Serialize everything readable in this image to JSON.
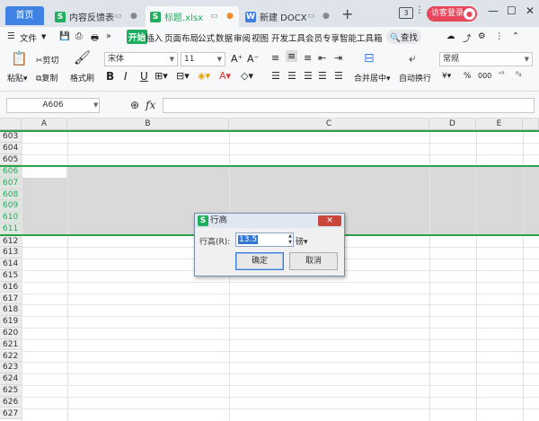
{
  "tabs": {
    "home": "首页",
    "doc1": "内容反馈表",
    "doc2": "标题.xlsx",
    "doc3": "新建 DOCX 文"
  },
  "window": {
    "badge": "3",
    "visitor": "访客登录"
  },
  "menu": {
    "file": "文件",
    "items": [
      "开始",
      "插入",
      "页面布局",
      "公式",
      "数据",
      "审阅",
      "视图",
      "开发工具",
      "会员专享",
      "智能工具箱"
    ],
    "search": "查找"
  },
  "ribbon": {
    "cut": "剪切",
    "paste": "粘贴",
    "copy": "复制",
    "format_painter": "格式刷",
    "font_name": "宋体",
    "font_size": "11",
    "bold": "B",
    "italic": "I",
    "underline": "U",
    "merge": "合并居中",
    "wrap": "自动换行",
    "number_format": "常规",
    "currency": "¥",
    "percent": "%",
    "thousands": "000"
  },
  "formula_bar": {
    "name_box": "A606",
    "fx": "fx"
  },
  "grid": {
    "columns": [
      "A",
      "B",
      "C",
      "D",
      "E"
    ],
    "rows": [
      "603",
      "604",
      "605",
      "606",
      "607",
      "608",
      "609",
      "610",
      "611",
      "612",
      "613",
      "614",
      "615",
      "616",
      "617",
      "618",
      "619",
      "620",
      "621",
      "622",
      "623",
      "624",
      "625",
      "626",
      "627"
    ],
    "selected_rows": [
      "606",
      "607",
      "608",
      "609",
      "610",
      "611"
    ]
  },
  "dialog": {
    "title": "行高",
    "label": "行高(R):",
    "value": "13.5",
    "unit": "磅",
    "ok": "确定",
    "cancel": "取消"
  },
  "colors": {
    "accent_green": "#1fae5d",
    "home_blue": "#3f82e4",
    "visitor_red": "#e8465a"
  }
}
